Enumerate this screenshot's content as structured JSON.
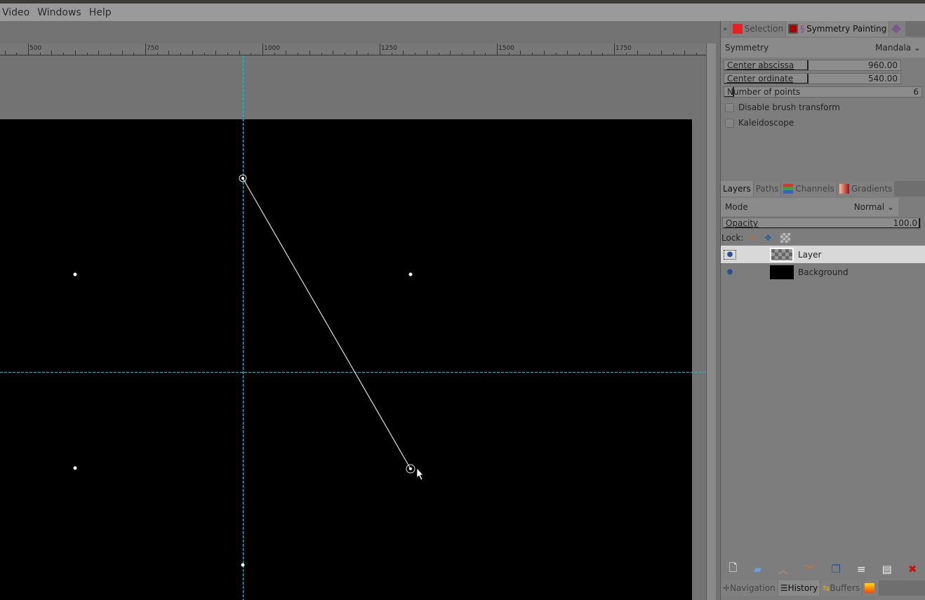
{
  "menu": [
    "Video",
    "Windows",
    "Help"
  ],
  "ruler": {
    "labels": [
      "500",
      "750",
      "1000",
      "1250",
      "1500",
      "1750"
    ]
  },
  "symmetry_panel": {
    "tabs": [
      "Selection",
      "Symmetry Painting"
    ],
    "symmetry_label": "Symmetry",
    "symmetry_value": "Mandala",
    "center_abscissa_label": "Center abscissa",
    "center_abscissa": "960.00",
    "center_ordinate_label": "Center ordinate",
    "center_ordinate": "540.00",
    "points_label": "Number of points",
    "points": "6",
    "disable_brush": "Disable brush transform",
    "kaleidoscope": "Kaleidoscope"
  },
  "layers_panel": {
    "tabs": [
      "Layers",
      "Paths",
      "Channels",
      "Gradients"
    ],
    "mode_label": "Mode",
    "mode_value": "Normal",
    "opacity_label": "Opacity",
    "opacity": "100.0",
    "lock_label": "Lock:",
    "layers": [
      {
        "name": "Layer"
      },
      {
        "name": "Background"
      }
    ]
  },
  "bottom_tabs": [
    "Navigation",
    "History",
    "Buffers"
  ],
  "colors": {
    "guide": "#00c8e0",
    "accent": "#e82020"
  }
}
